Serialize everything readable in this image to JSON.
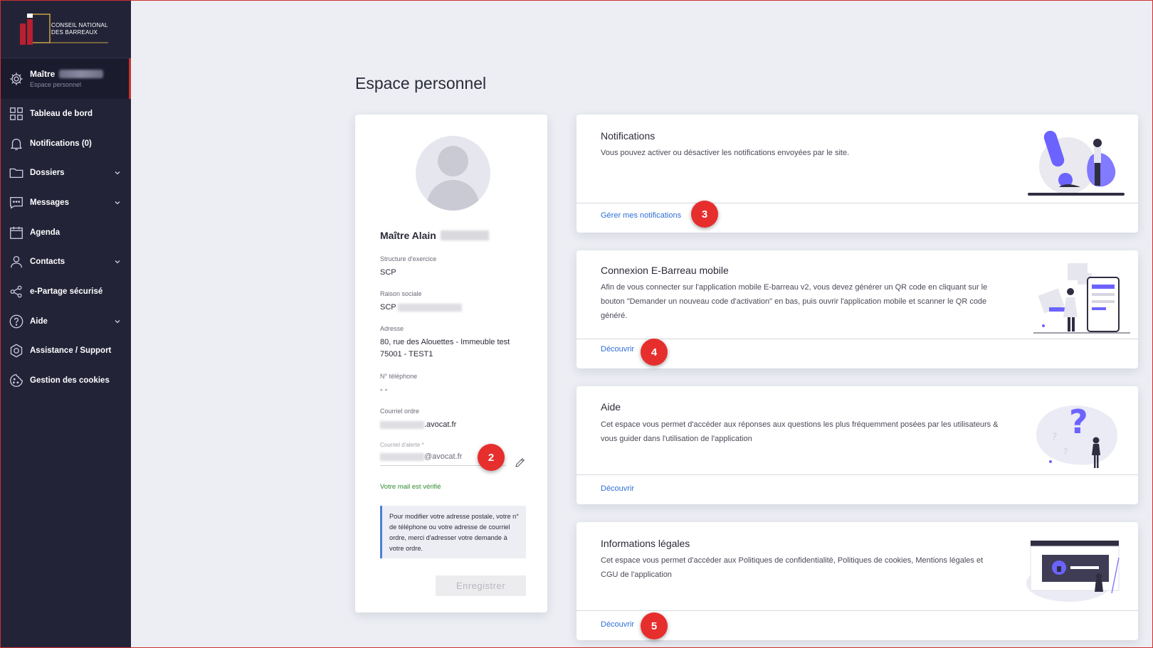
{
  "brand": {
    "line1": "CONSEIL NATIONAL",
    "line2": "DES BARREAUX"
  },
  "user": {
    "name": "Maître",
    "subtitle": "Espace personnel"
  },
  "nav": [
    {
      "label": "Tableau de bord",
      "icon": "dashboard-icon",
      "expandable": false
    },
    {
      "label": "Notifications (0)",
      "icon": "bell-icon",
      "expandable": false
    },
    {
      "label": "Dossiers",
      "icon": "folder-icon",
      "expandable": true
    },
    {
      "label": "Messages",
      "icon": "chat-icon",
      "expandable": true
    },
    {
      "label": "Agenda",
      "icon": "calendar-icon",
      "expandable": false
    },
    {
      "label": "Contacts",
      "icon": "contact-icon",
      "expandable": true
    },
    {
      "label": "e-Partage sécurisé",
      "icon": "share-icon",
      "expandable": false
    },
    {
      "label": "Aide",
      "icon": "help-icon",
      "expandable": true
    },
    {
      "label": "Assistance / Support",
      "icon": "support-icon",
      "expandable": false
    },
    {
      "label": "Gestion des cookies",
      "icon": "cookie-icon",
      "expandable": false
    }
  ],
  "page": {
    "title": "Espace personnel"
  },
  "profile": {
    "name": "Maître Alain",
    "structure_label": "Structure d'exercice",
    "structure_value": "SCP",
    "raison_label": "Raison sociale",
    "raison_value": "SCP",
    "address_label": "Adresse",
    "address_line1": "80, rue des Alouettes - Immeuble test",
    "address_line2": "75001 - TEST1",
    "phone_label": "N° téléphone",
    "phone_value": "- -",
    "email_order_label": "Courriel ordre",
    "email_order_domain": ".avocat.fr",
    "alert_email_label": "Courriel d'alerte *",
    "alert_email_domain": "@avocat.fr",
    "verified_text": "Votre mail est vérifié",
    "info_text": "Pour modifier votre adresse postale, votre n° de téléphone ou votre adresse de courriel ordre, merci d'adresser votre demande à votre ordre.",
    "save_label": "Enregistrer"
  },
  "cards": [
    {
      "title": "Notifications",
      "description": "Vous pouvez activer ou désactiver les notifications envoyées par le site.",
      "link": "Gérer mes notifications"
    },
    {
      "title": "Connexion E-Barreau mobile",
      "description": "Afin de vous connecter sur l'application mobile E-barreau v2, vous devez générer un QR code en cliquant sur le bouton \"Demander un nouveau code d'activation\" en bas, puis ouvrir l'application mobile et scanner le QR code généré.",
      "link": "Découvrir"
    },
    {
      "title": "Aide",
      "description": "Cet espace vous permet d'accéder aux réponses aux questions les plus fréquemment posées par les utilisateurs & vous guider dans l'utilisation de l'application",
      "link": "Découvrir"
    },
    {
      "title": "Informations légales",
      "description": "Cet espace vous permet d'accéder aux Politiques de confidentialité, Politiques de cookies, Mentions légales et CGU de l'application",
      "link": "Découvrir"
    }
  ],
  "badges": [
    "2",
    "3",
    "4",
    "5"
  ],
  "colors": {
    "sidebar": "#232338",
    "accent_link": "#2f6fd6",
    "badge": "#e62e2d",
    "illustration": "#6c63ff"
  }
}
